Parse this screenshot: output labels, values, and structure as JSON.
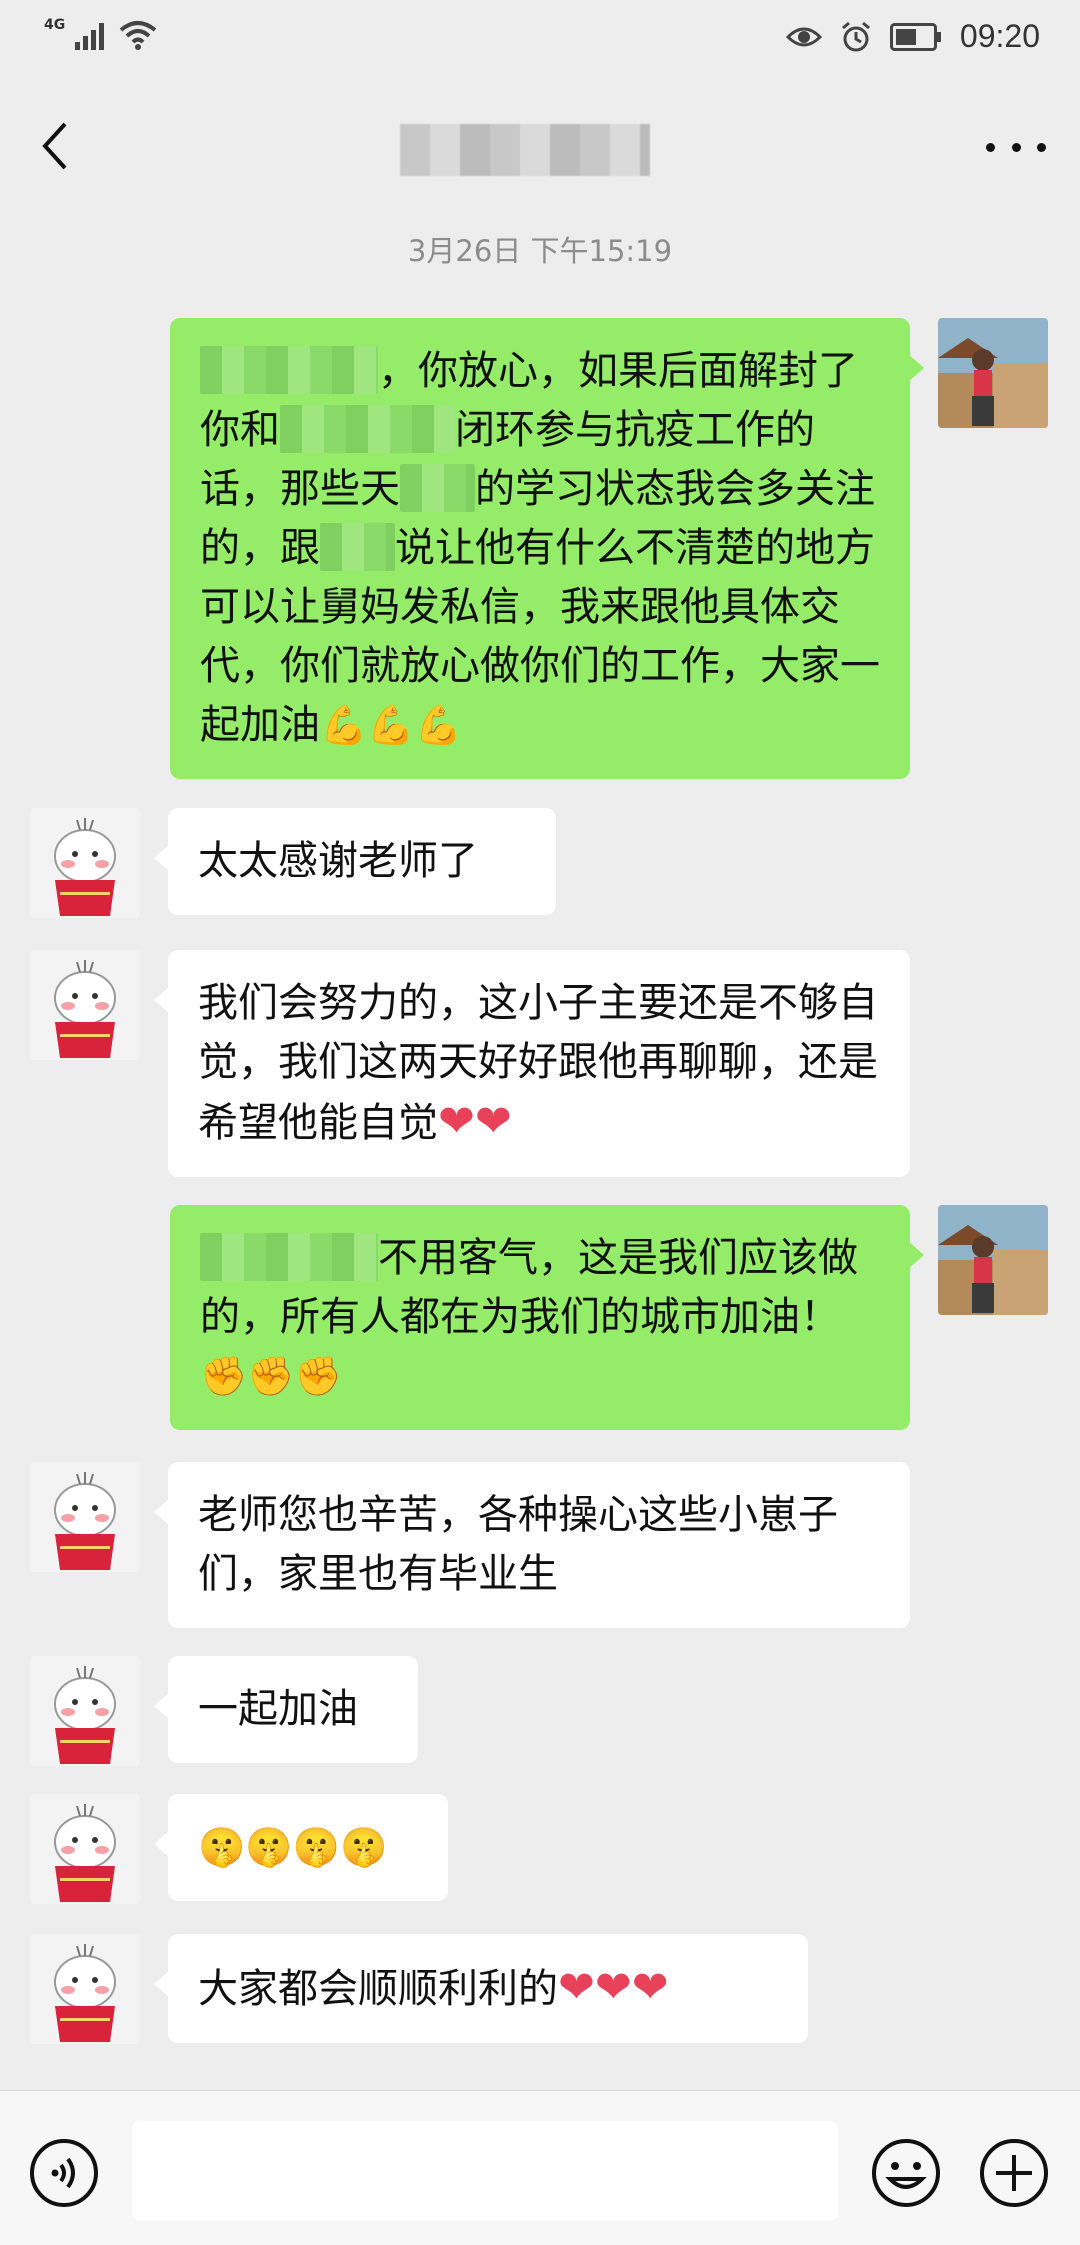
{
  "status_bar": {
    "network": "4G",
    "time": "09:20"
  },
  "nav": {
    "title": ""
  },
  "chat": {
    "timestamp": "3月26日 下午15:19",
    "messages": [
      {
        "direction": "out",
        "segments": [
          "，你放心，如果后面解封了你和",
          "闭环参与抗疫工作的话，那些天",
          "的学习状态我会多关注的，跟",
          "说让他有什么不清楚的地方可以让舅妈发私信，我来跟他具体交代，你们就放心做你们的工作，大家一起加油"
        ],
        "emoji": "💪💪💪"
      },
      {
        "direction": "in",
        "text": "太太感谢老师了"
      },
      {
        "direction": "in",
        "text": "我们会努力的，这小子主要还是不够自觉，我们这两天好好跟他再聊聊，还是希望他能自觉",
        "emoji": "❤❤"
      },
      {
        "direction": "out",
        "text": "不用客气，这是我们应该做的，所有人都在为我们的城市加油！",
        "emoji": "✊✊✊"
      },
      {
        "direction": "in",
        "text": "老师您也辛苦，各种操心这些小崽子们，家里也有毕业生"
      },
      {
        "direction": "in",
        "text": "一起加油"
      },
      {
        "direction": "in",
        "emoji": "🤫🤫🤫🤫"
      },
      {
        "direction": "in",
        "text": "大家都会顺顺利利的",
        "emoji": "❤❤❤"
      }
    ]
  },
  "colors": {
    "background": "#ededed",
    "outgoing_bubble": "#95ec69",
    "incoming_bubble": "#ffffff"
  },
  "icons": {
    "back": "chevron-left-icon",
    "more": "more-dots-icon",
    "voice": "voice-icon",
    "emoji": "emoji-icon",
    "plus": "plus-icon"
  }
}
